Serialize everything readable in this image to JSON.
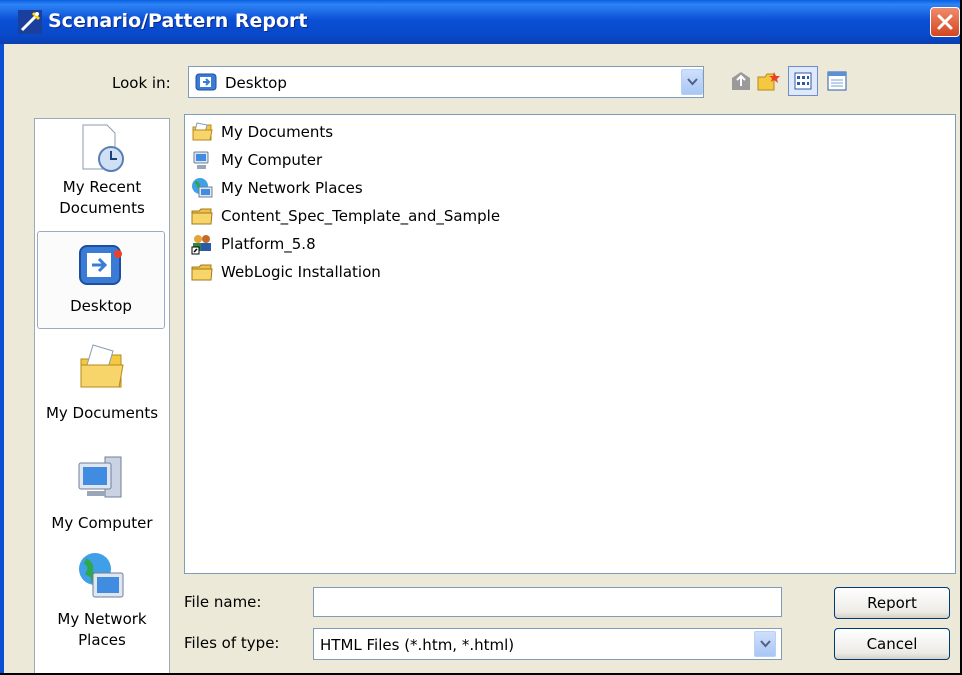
{
  "window": {
    "title": "Scenario/Pattern Report"
  },
  "look_in": {
    "label": "Look in:",
    "value": "Desktop"
  },
  "places": [
    {
      "label_line1": "My Recent",
      "label_line2": "Documents"
    },
    {
      "label_line1": "Desktop",
      "label_line2": ""
    },
    {
      "label_line1": "My Documents",
      "label_line2": ""
    },
    {
      "label_line1": "My Computer",
      "label_line2": ""
    },
    {
      "label_line1": "My Network",
      "label_line2": "Places"
    }
  ],
  "files": [
    {
      "name": "My Documents",
      "icon": "my-documents-icon"
    },
    {
      "name": "My Computer",
      "icon": "computer-icon"
    },
    {
      "name": "My Network Places",
      "icon": "network-places-icon"
    },
    {
      "name": "Content_Spec_Template_and_Sample",
      "icon": "folder-icon"
    },
    {
      "name": "Platform_5.8",
      "icon": "users-shortcut-icon"
    },
    {
      "name": "WebLogic Installation",
      "icon": "folder-icon"
    }
  ],
  "file_name": {
    "label": "File name:",
    "value": ""
  },
  "file_type": {
    "label": "Files of type:",
    "value": "HTML Files (*.htm, *.html)"
  },
  "buttons": {
    "report": "Report",
    "cancel": "Cancel"
  },
  "colors": {
    "titlebar": "#0a4fd6",
    "dialog_bg": "#ece9d8",
    "close_button": "#d3461f",
    "list_bg": "#ffffff"
  }
}
